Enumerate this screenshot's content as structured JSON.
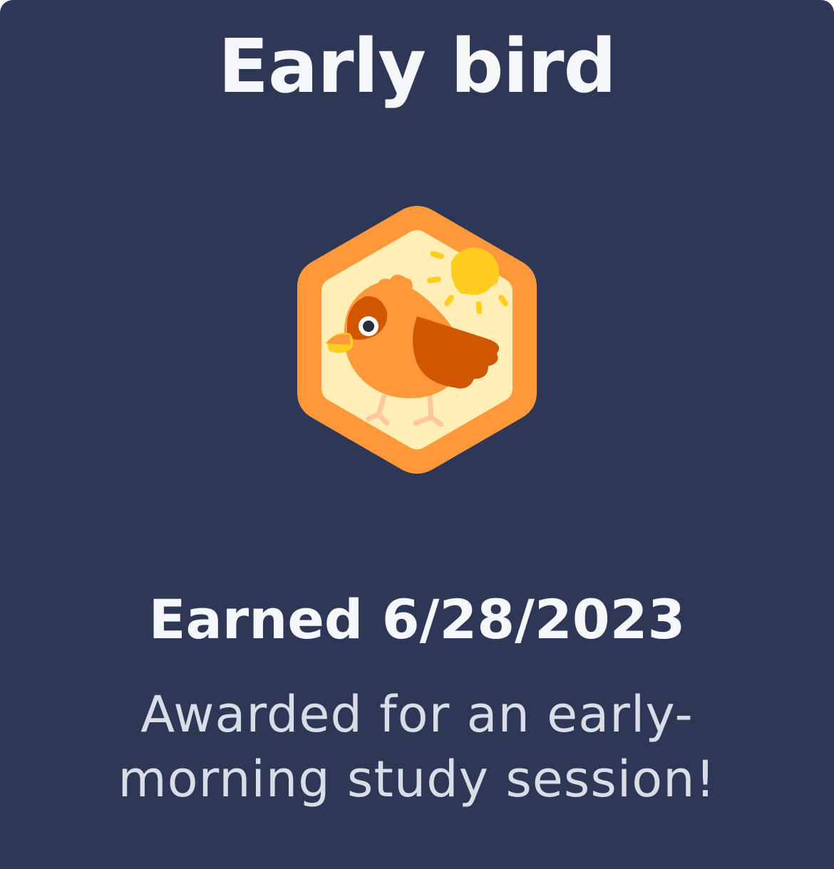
{
  "badge": {
    "title": "Early bird",
    "earned_text": "Earned 6/28/2023",
    "description": "Awarded for an early-morning study session!",
    "icon": "early-bird-badge-icon"
  },
  "colors": {
    "background": "#2e3856",
    "text_primary": "#f6f7fb",
    "text_secondary": "#d9dde8",
    "badge_border": "#ff983a",
    "badge_inner": "#ffefb6",
    "sun": "#ffcd1f",
    "bird_body": "#ff983a",
    "bird_wing": "#d05700"
  }
}
